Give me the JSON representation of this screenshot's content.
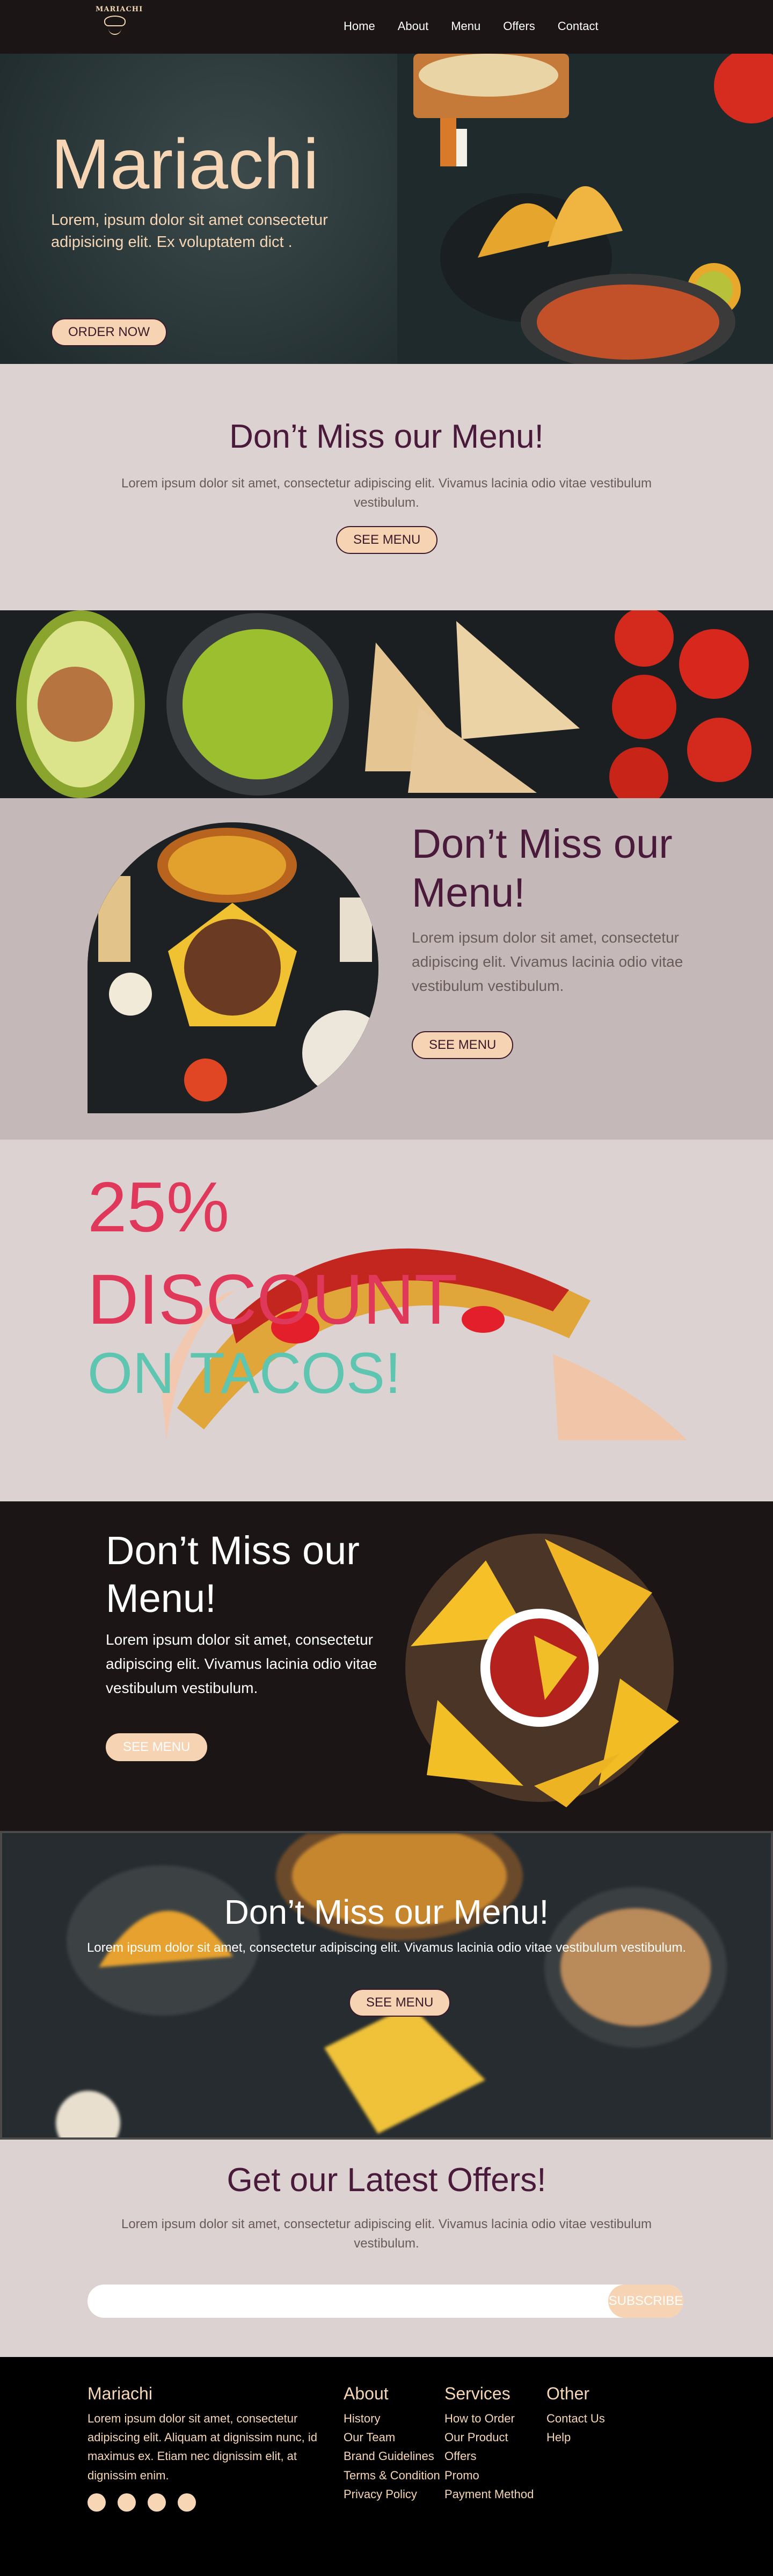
{
  "nav": {
    "logo": "MARIACHI",
    "links": [
      "Home",
      "About",
      "Menu",
      "Offers",
      "Contact"
    ]
  },
  "hero": {
    "title": "Mariachi",
    "text": "Lorem, ipsum dolor sit amet consectetur adipisicing elit. Ex voluptatem dict .",
    "button": "ORDER NOW"
  },
  "section1": {
    "title": "Don’t Miss our Menu!",
    "text": "Lorem ipsum dolor sit amet, consectetur adipiscing elit. Vivamus lacinia odio vitae vestibulum vestibulum.",
    "button": "SEE MENU"
  },
  "section2": {
    "title": "Don’t Miss our Menu!",
    "text": "Lorem ipsum dolor sit amet, consectetur adipiscing elit. Vivamus lacinia odio vitae vestibulum vestibulum.",
    "button": "SEE MENU"
  },
  "discount": {
    "line1": "25%",
    "line2": "DISCOUNT",
    "line3": "ON TACOS!"
  },
  "section4": {
    "title": "Don’t Miss our Menu!",
    "text": "Lorem ipsum dolor sit amet, consectetur adipiscing elit. Vivamus lacinia odio vitae vestibulum vestibulum.",
    "button": "SEE MENU"
  },
  "section5": {
    "title": "Don’t Miss our Menu!",
    "text": "Lorem ipsum dolor sit amet, consectetur adipiscing elit. Vivamus lacinia odio vitae vestibulum vestibulum.",
    "button": "SEE MENU"
  },
  "offers": {
    "title": "Get our Latest Offers!",
    "text": "Lorem ipsum dolor sit amet, consectetur adipiscing elit. Vivamus lacinia odio vitae vestibulum vestibulum.",
    "button": "SUBSCRIBE"
  },
  "footer": {
    "brand": "Mariachi",
    "text": "Lorem ipsum dolor sit amet, consectetur adipiscing elit. Aliquam at dignissim nunc, id maximus ex. Etiam nec dignissim elit, at dignissim enim.",
    "about_title": "About",
    "about_links": [
      "History",
      "Our Team",
      "Brand Guidelines",
      "Terms & Condition",
      "Privacy Policy"
    ],
    "services_title": "Services",
    "services_links": [
      "How to Order",
      "Our Product",
      "Offers",
      "Promo",
      "Payment Method"
    ],
    "other_title": "Other",
    "other_links": [
      "Contact Us",
      "Help"
    ],
    "social_icons": [
      "facebook-icon",
      "youtube-icon",
      "instagram-icon",
      "twitter-icon"
    ]
  },
  "colors": {
    "accent": "#f6d3b3",
    "plum": "#4a1a3a",
    "dark": "#1b1515",
    "discount_red": "#e0385a",
    "discount_teal": "#5ec5b0"
  }
}
